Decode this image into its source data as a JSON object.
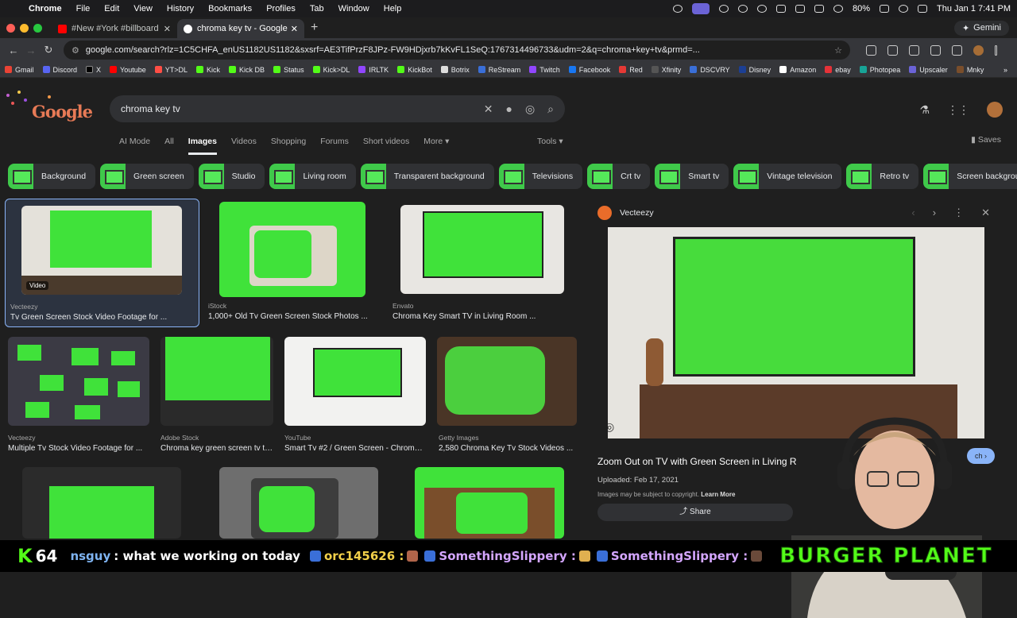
{
  "menubar": {
    "app": "Chrome",
    "items": [
      "File",
      "Edit",
      "View",
      "History",
      "Bookmarks",
      "Profiles",
      "Tab",
      "Window",
      "Help"
    ],
    "battery": "80%",
    "datetime": "Thu Jan 1  7:41 PM"
  },
  "tabs": [
    {
      "title": "#New #York #billboard #Gre"
    },
    {
      "title": "chroma key tv - Google Searc"
    }
  ],
  "gemini_label": "Gemini",
  "url": "google.com/search?rlz=1C5CHFA_enUS1182US1182&sxsrf=AE3TifPrzF8JPz-FW9HDjxrb7kKvFL1SeQ:1767314496733&udm=2&q=chroma+key+tv&prmd=...",
  "bookmarks": [
    "Gmail",
    "Discord",
    "X",
    "Youtube",
    "YT>DL",
    "Kick",
    "Kick DB",
    "Status",
    "Kick>DL",
    "IRLTK",
    "KickBot",
    "Botrix",
    "ReStream",
    "Twitch",
    "Facebook",
    "Red",
    "Xfinity",
    "DSCVRY",
    "Disney",
    "Amazon",
    "ebay",
    "Photopea",
    "Upscaler",
    "Mnky"
  ],
  "search": {
    "query": "chroma key tv"
  },
  "gtabs": [
    "AI Mode",
    "All",
    "Images",
    "Videos",
    "Shopping",
    "Forums",
    "Short videos",
    "More"
  ],
  "tools_label": "Tools",
  "saves_label": "Saves",
  "chips": [
    "Background",
    "Green screen",
    "Studio",
    "Living room",
    "Transparent background",
    "Televisions",
    "Crt tv",
    "Smart tv",
    "Vintage television",
    "Retro tv",
    "Screen background"
  ],
  "results": [
    {
      "source": "Vecteezy",
      "title": "Tv Green Screen Stock Video Footage for ...",
      "badge": "Video"
    },
    {
      "source": "iStock",
      "title": "1,000+ Old Tv Green Screen Stock Photos ..."
    },
    {
      "source": "Envato",
      "title": "Chroma Key Smart TV in Living Room ..."
    },
    {
      "source": "Vecteezy",
      "title": "Multiple Tv Stock Video Footage for ..."
    },
    {
      "source": "Adobe Stock",
      "title": "Chroma key green screen tv tel..."
    },
    {
      "source": "YouTube",
      "title": "Smart Tv #2 / Green Screen - Chroma ..."
    },
    {
      "source": "Getty Images",
      "title": "2,580 Chroma Key Tv Stock Videos ..."
    }
  ],
  "panel": {
    "source": "Vecteezy",
    "title": "Zoom Out on TV with Green Screen in Living R",
    "uploaded": "Uploaded: Feb 17, 2021",
    "copyright": "Images may be subject to copyright.",
    "learn_more": "Learn More",
    "share": "Share",
    "visit": "ch"
  },
  "ticker": {
    "count": "64",
    "user1": "nsguy",
    "msg1": ": what we working on today",
    "user2": "orc145626 :",
    "user3": "SomethingSlippery :",
    "user4": "SomethingSlippery :",
    "brand": "BURGER PLANET"
  }
}
